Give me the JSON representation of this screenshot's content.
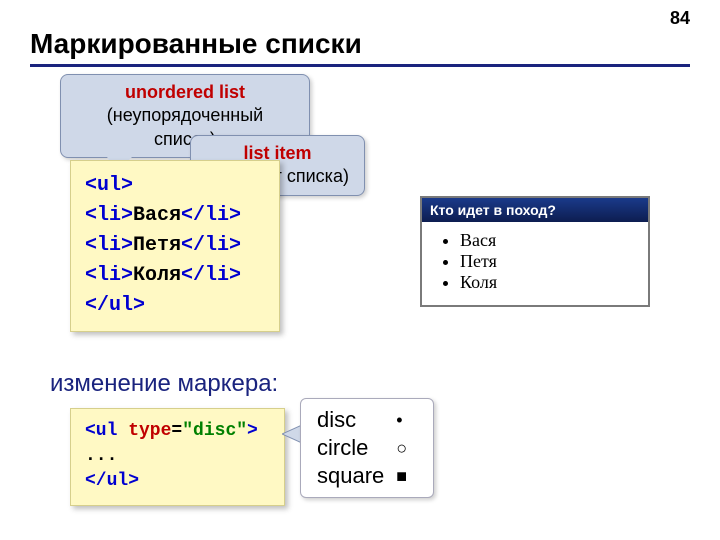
{
  "slide_number": "84",
  "title": "Маркированные списки",
  "callout_ul": {
    "title": "unordered list",
    "sub": "(неупорядоченный список)"
  },
  "callout_li": {
    "title": "list item",
    "sub": "(элемент списка)"
  },
  "code1": {
    "open_ul": "<ul>",
    "open_li": "<li>",
    "close_li": "</li>",
    "items": [
      "Вася",
      "Петя",
      "Коля"
    ],
    "close_ul": "</ul>"
  },
  "browser": {
    "title": "Кто идет в поход?",
    "items": [
      "Вася",
      "Петя",
      "Коля"
    ]
  },
  "subheading": "изменение маркера:",
  "code2": {
    "open": "<ul",
    "attr": " type",
    "eq": "=",
    "val": "\"disc\"",
    "close_open": ">",
    "ellipsis": "...",
    "close": "</ul>"
  },
  "markers": {
    "rows": [
      {
        "name": "disc",
        "symbol": "•"
      },
      {
        "name": "circle",
        "symbol": "○"
      },
      {
        "name": "square",
        "symbol": "■"
      }
    ]
  }
}
